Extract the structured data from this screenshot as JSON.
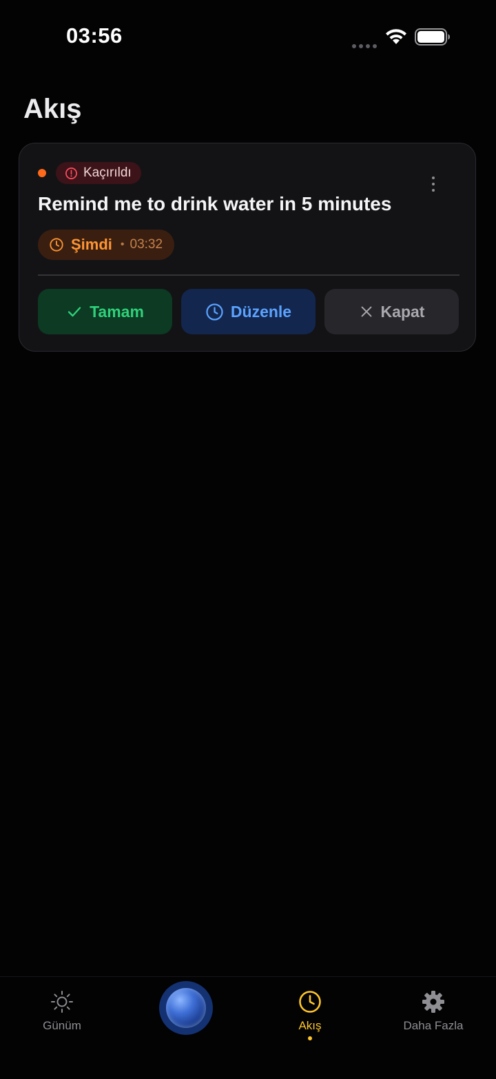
{
  "status_bar": {
    "time": "03:56"
  },
  "page": {
    "title": "Akış"
  },
  "card": {
    "badge_label": "Kaçırıldı",
    "title": "Remind me to drink water in 5 minutes",
    "time_chip": {
      "now_label": "Şimdi",
      "separator": "•",
      "time": "03:32"
    },
    "actions": {
      "done_label": "Tamam",
      "edit_label": "Düzenle",
      "close_label": "Kapat"
    }
  },
  "tab_bar": {
    "items": [
      {
        "label": "Günüm",
        "icon": "sun-icon"
      },
      {
        "label": "",
        "icon": "orb-icon"
      },
      {
        "label": "Akış",
        "icon": "clock-icon",
        "active": true
      },
      {
        "label": "Daha Fazla",
        "icon": "gear-icon"
      }
    ]
  },
  "colors": {
    "accent": "#ffc62a",
    "missed": "#ff4d5e",
    "done": "#2fd17a",
    "edit": "#5ba3ff",
    "now": "#ff9533"
  }
}
